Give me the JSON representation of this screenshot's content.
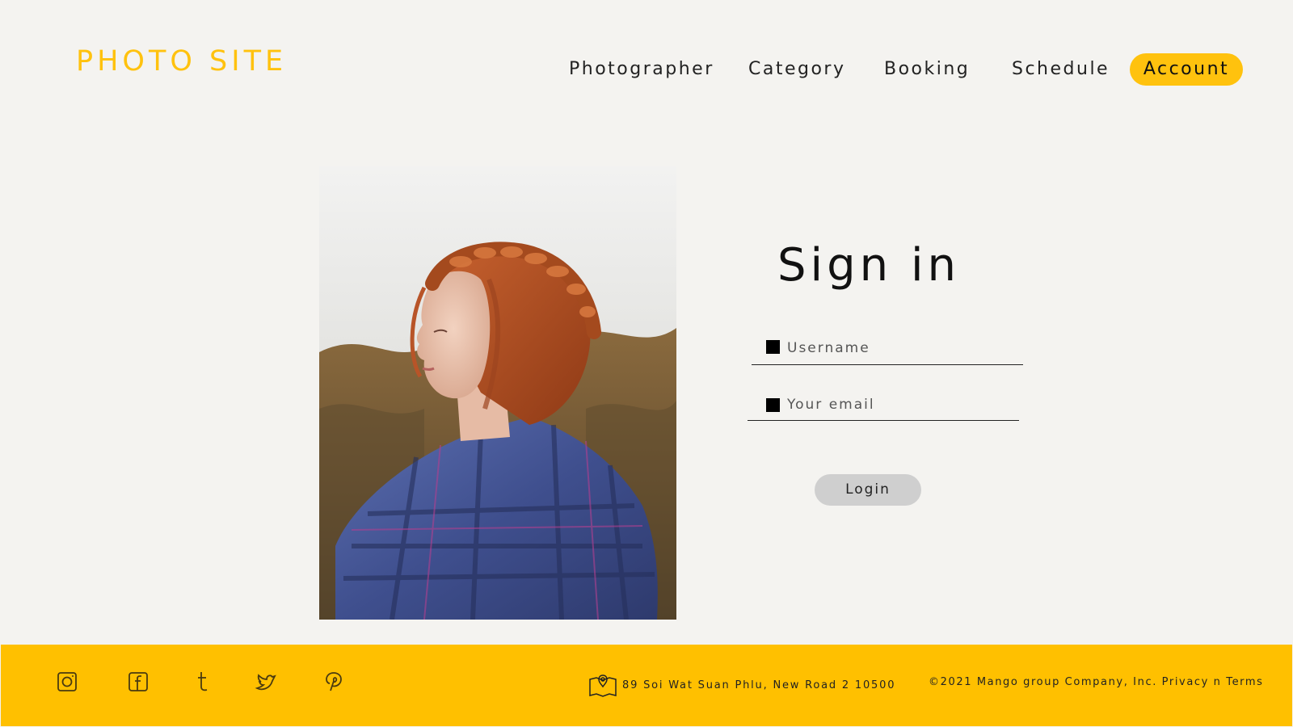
{
  "header": {
    "logo": "PHOTO SITE",
    "nav": {
      "photographer": "Photographer",
      "category": "Category",
      "booking": "Booking",
      "schedule": "Schedule",
      "account": "Account"
    }
  },
  "signin": {
    "title": "Sign in",
    "username_placeholder": "Username",
    "email_placeholder": "Your email",
    "login_label": "Login"
  },
  "footer": {
    "social_icons": [
      "instagram-icon",
      "facebook-icon",
      "tumblr-icon",
      "twitter-icon",
      "pinterest-icon"
    ],
    "address": "89 Soi Wat Suan Phlu, New Road 2 10500",
    "copyright": "©2021 Mango group Company, Inc. Privacy n Terms"
  },
  "colors": {
    "accent": "#ffc20e",
    "footer": "#ffc000",
    "background": "#f4f3f0",
    "button": "#cfcfcf"
  }
}
